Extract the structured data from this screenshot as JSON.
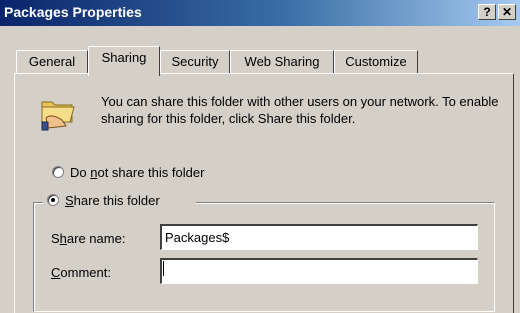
{
  "window": {
    "title": "Packages Properties",
    "help_label": "?",
    "close_label": "✕"
  },
  "tabs": [
    {
      "label": "General",
      "active": false
    },
    {
      "label": "Sharing",
      "active": true
    },
    {
      "label": "Security",
      "active": false
    },
    {
      "label": "Web Sharing",
      "active": false
    },
    {
      "label": "Customize",
      "active": false
    }
  ],
  "sharing": {
    "icon": "shared-folder-icon",
    "description": "You can share this folder with other users on your network.  To enable sharing for this folder, click Share this folder.",
    "option_not_share": {
      "before": "Do ",
      "accel": "n",
      "after": "ot share this folder",
      "checked": false
    },
    "option_share": {
      "before": "",
      "accel": "S",
      "after": "hare this folder",
      "checked": true
    },
    "share_name": {
      "before": "S",
      "accel": "h",
      "after": "are name:",
      "value": "Packages$"
    },
    "comment": {
      "before": "",
      "accel": "C",
      "after": "omment:",
      "value": ""
    }
  }
}
